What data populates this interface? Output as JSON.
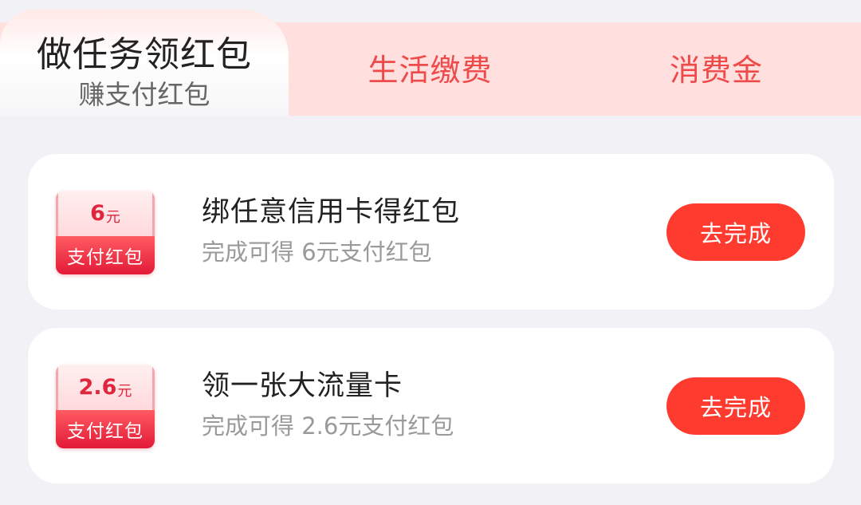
{
  "tabs": {
    "active": {
      "title": "做任务领红包",
      "subtitle": "赚支付红包"
    },
    "utility_label": "生活缴费",
    "consume_label": "消费金"
  },
  "tasks": [
    {
      "badge_amount": "6",
      "badge_unit": "元",
      "badge_label": "支付红包",
      "title": "绑任意信用卡得红包",
      "description": "完成可得 6元支付红包",
      "button_label": "去完成"
    },
    {
      "badge_amount": "2.6",
      "badge_unit": "元",
      "badge_label": "支付红包",
      "title": "领一张大流量卡",
      "description": "完成可得 2.6元支付红包",
      "button_label": "去完成"
    }
  ],
  "colors": {
    "accent": "#ff3b2f",
    "tab_strip": "#ffe0de",
    "tab_text": "#ee4a4a",
    "badge_red": "#e21a36",
    "page_bg": "#f2f2f6"
  }
}
